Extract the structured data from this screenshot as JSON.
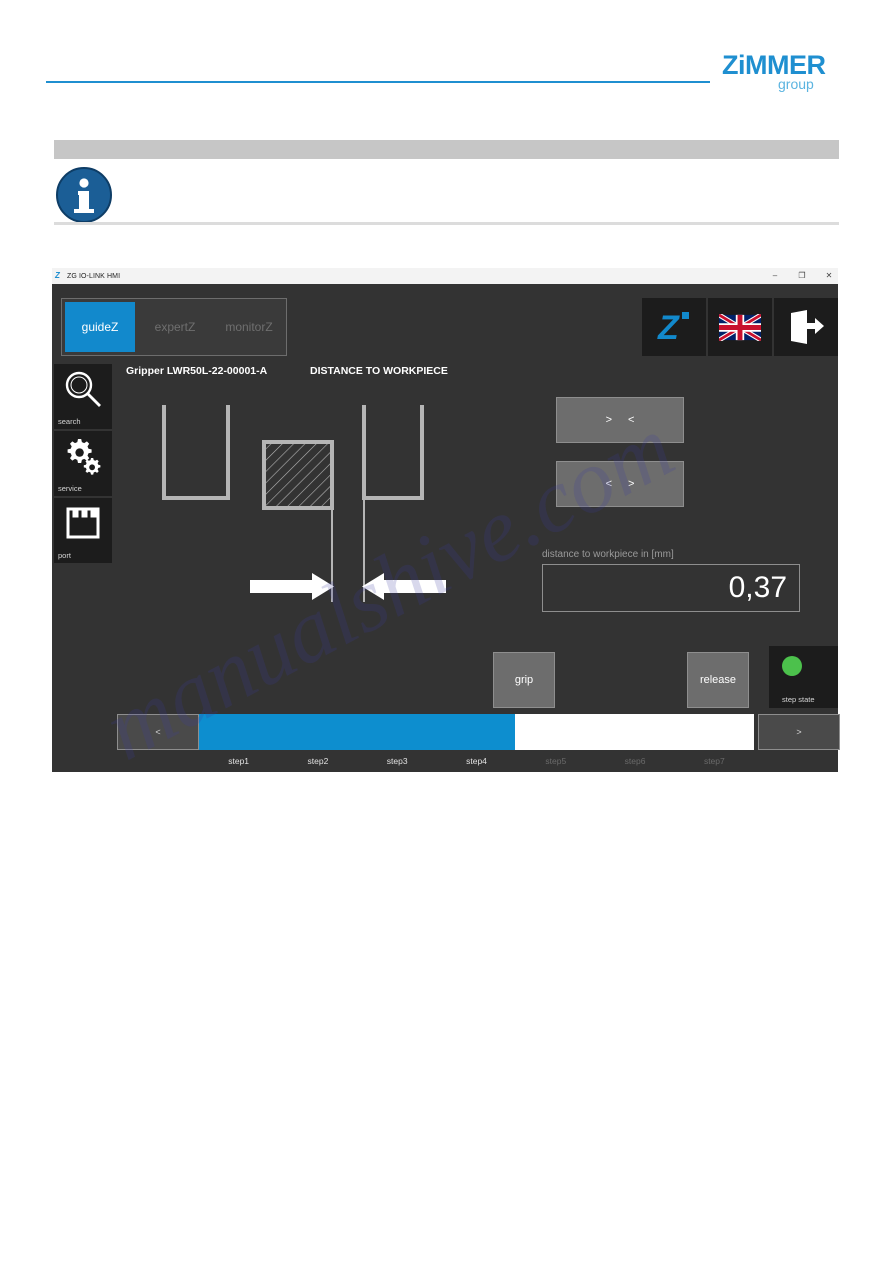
{
  "document": {
    "brand_logo_text": "ZIMMER",
    "brand_logo_subtext": "group",
    "accent_color": "#1f8fd0",
    "info_icon": "info-icon",
    "watermark_text": "manualshive.com"
  },
  "window": {
    "app_icon": "zimmer-z-icon",
    "title": "ZG IO-LINK HMI",
    "controls": {
      "minimize": "–",
      "maximize": "❐",
      "close": "✕"
    }
  },
  "tabs": [
    {
      "label": "guideZ",
      "active": true
    },
    {
      "label": "expertZ",
      "active": false
    },
    {
      "label": "monitorZ",
      "active": false
    }
  ],
  "header_icons": [
    {
      "name": "zimmer-logo-icon"
    },
    {
      "name": "uk-flag-icon"
    },
    {
      "name": "logout-icon"
    }
  ],
  "sidebar": {
    "items": [
      {
        "label": "search",
        "icon": "magnifier-icon"
      },
      {
        "label": "service",
        "icon": "gears-icon"
      },
      {
        "label": "port",
        "icon": "ethernet-port-icon"
      }
    ]
  },
  "main": {
    "gripper_title": "Gripper LWR50L-22-00001-A",
    "screen_title": "DISTANCE TO WORKPIECE",
    "jog_close_left": ">",
    "jog_close_right": "<",
    "jog_open_left": "<",
    "jog_open_right": ">",
    "distance_label": "distance to workpiece in [mm]",
    "distance_value": "0,37",
    "grip_label": "grip",
    "release_label": "release",
    "step_state_label": "step state",
    "step_state_color": "#4cc14c"
  },
  "footer": {
    "prev_label": "<",
    "next_label": ">",
    "progress_percent": 57,
    "progress_fill_color": "#0d8ecf",
    "steps": [
      {
        "label": "step1",
        "done": true
      },
      {
        "label": "step2",
        "done": true
      },
      {
        "label": "step3",
        "done": true
      },
      {
        "label": "step4",
        "done": true
      },
      {
        "label": "step5",
        "done": false
      },
      {
        "label": "step6",
        "done": false
      },
      {
        "label": "step7",
        "done": false
      }
    ]
  }
}
